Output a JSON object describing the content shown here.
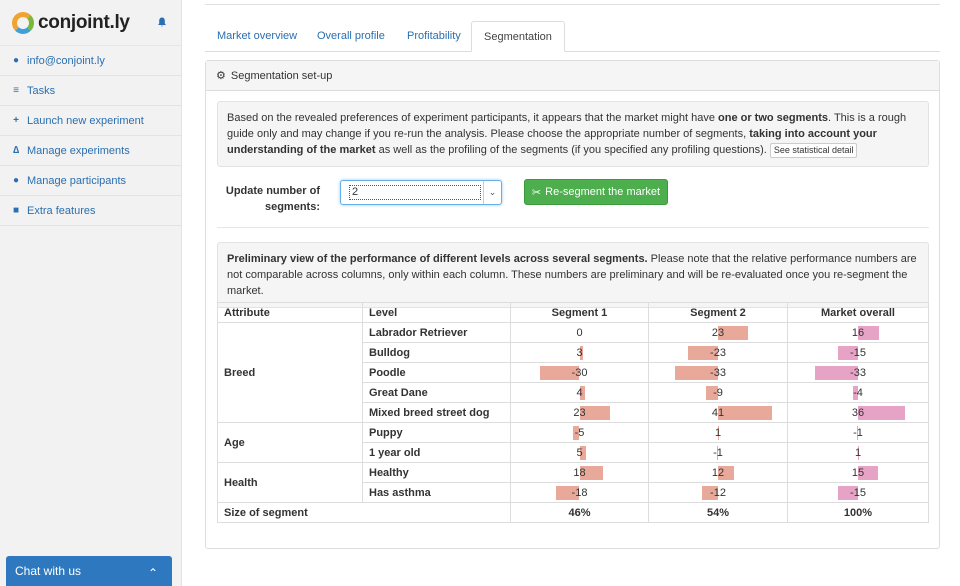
{
  "sidebar": {
    "logo": "conjoint.ly",
    "items": [
      {
        "label": "info@conjoint.ly",
        "icon": "user-icon"
      },
      {
        "label": "Tasks",
        "icon": "list-icon"
      },
      {
        "label": "Launch new experiment",
        "icon": "plus-icon"
      },
      {
        "label": "Manage experiments",
        "icon": "flask-icon"
      },
      {
        "label": "Manage participants",
        "icon": "users-icon"
      },
      {
        "label": "Extra features",
        "icon": "briefcase-icon"
      }
    ],
    "chat": "Chat with us"
  },
  "tabs": [
    "Market overview",
    "Overall profile",
    "Profitability",
    "Segmentation"
  ],
  "active_tab": "Segmentation",
  "panel": {
    "title": "Segmentation set-up",
    "intro": {
      "t1": "Based on the revealed preferences of experiment participants, it appears that the market might have ",
      "b1": "one or two segments",
      "t2": ". This is a rough guide only and may change if you re-run the analysis. Please choose the appropriate number of segments, ",
      "b2": "taking into account your understanding of the market",
      "t3": " as well as the profiling of the segments (if you specified any profiling questions).",
      "detail_button": "See statistical detail"
    },
    "update_label": "Update number of segments:",
    "segments_value": "2",
    "resegment_button": "Re-segment the market",
    "preliminary": {
      "b": "Preliminary view of the performance of different levels across several segments.",
      "t": " Please note that the relative performance numbers are not comparable across columns, only within each column. These numbers are preliminary and will be re-evaluated once you re-segment the market."
    }
  },
  "table": {
    "headers": [
      "Attribute",
      "Level",
      "Segment 1",
      "Segment 2",
      "Market overall"
    ],
    "groups": [
      {
        "attribute": "Breed",
        "rows": [
          {
            "level": "Labrador Retriever",
            "values": [
              0,
              23,
              16
            ]
          },
          {
            "level": "Bulldog",
            "values": [
              3,
              -23,
              -15
            ]
          },
          {
            "level": "Poodle",
            "values": [
              -30,
              -33,
              -33
            ]
          },
          {
            "level": "Great Dane",
            "values": [
              4,
              -9,
              -4
            ]
          },
          {
            "level": "Mixed breed street dog",
            "values": [
              23,
              41,
              36
            ]
          }
        ]
      },
      {
        "attribute": "Age",
        "rows": [
          {
            "level": "Puppy",
            "values": [
              -5,
              1,
              -1
            ]
          },
          {
            "level": "1 year old",
            "values": [
              5,
              -1,
              1
            ]
          }
        ]
      },
      {
        "attribute": "Health",
        "rows": [
          {
            "level": "Healthy",
            "values": [
              18,
              12,
              15
            ]
          },
          {
            "level": "Has asthma",
            "values": [
              -18,
              -12,
              -15
            ]
          }
        ]
      }
    ],
    "total": {
      "label": "Size of segment",
      "values": [
        "46%",
        "54%",
        "100%"
      ]
    },
    "colors": {
      "segment": "#e8a89a",
      "market": "#e7a3c5"
    }
  }
}
